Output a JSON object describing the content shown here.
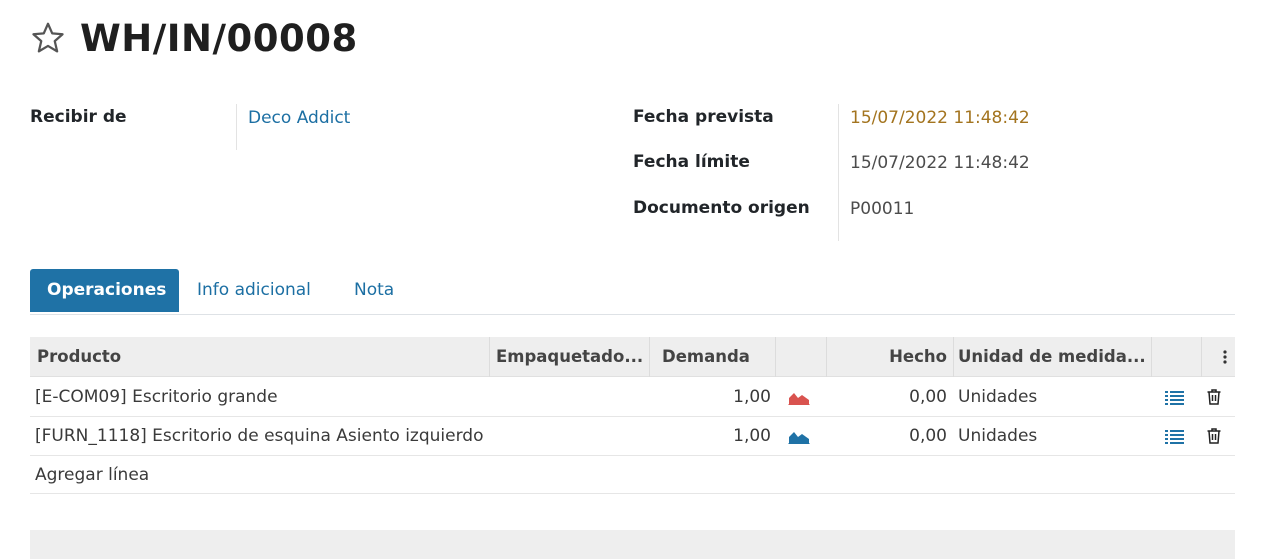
{
  "record": {
    "title": "WH/IN/00008"
  },
  "fields": {
    "receive_from_label": "Recibir de",
    "receive_from_value": "Deco Addict",
    "scheduled_date_label": "Fecha prevista",
    "scheduled_date_value": "15/07/2022 11:48:42",
    "deadline_label": "Fecha límite",
    "deadline_value": "15/07/2022 11:48:42",
    "source_doc_label": "Documento origen",
    "source_doc_value": "P00011"
  },
  "tabs": [
    {
      "label": "Operaciones",
      "active": true
    },
    {
      "label": "Info adicional",
      "active": false
    },
    {
      "label": "Nota",
      "active": false
    }
  ],
  "table": {
    "columns": {
      "product": "Producto",
      "package": "Empaquetado...",
      "demand": "Demanda",
      "done": "Hecho",
      "uom": "Unidad de medida..."
    },
    "rows": [
      {
        "product": "[E-COM09] Escritorio grande",
        "demand": "1,00",
        "done": "0,00",
        "uom": "Unidades",
        "forecast_icon": "area-chart-icon",
        "forecast_color": "#d9534f"
      },
      {
        "product": "[FURN_1118] Escritorio de esquina Asiento izquierdo",
        "demand": "1,00",
        "done": "0,00",
        "uom": "Unidades",
        "forecast_icon": "area-chart-icon",
        "forecast_color": "#1f72a6"
      }
    ],
    "add_line": "Agregar línea"
  },
  "colors": {
    "primary": "#1f72a6",
    "link": "#1c6fa3",
    "warning_date": "#a3741f"
  }
}
